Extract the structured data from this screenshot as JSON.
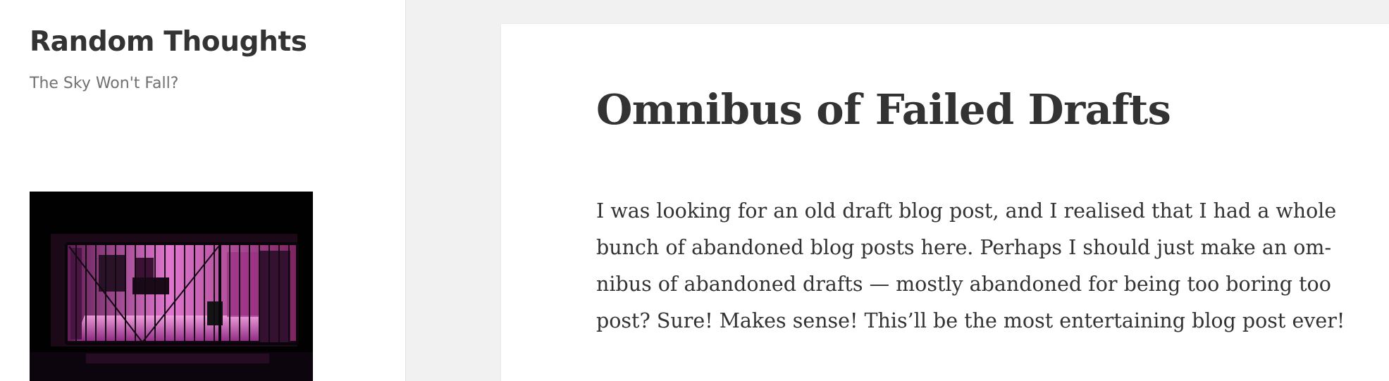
{
  "site": {
    "title": "Random Thoughts",
    "description": "The Sky Won't Fall?"
  },
  "sidebar": {
    "photo_icon": "widget-photo"
  },
  "post": {
    "title": "Omnibus of Failed Drafts",
    "body_lines": [
      "I was looking for an old draft blog post, and I realised that I had a whole",
      "bunch of abandoned blog posts here. Perhaps I should just make an om-",
      "nibus of abandoned drafts — mostly abandoned for being too boring too",
      "post? Sure! Makes sense! This’ll be the most entertaining blog post ever!"
    ]
  },
  "colors": {
    "page_background": "#f1f1f1",
    "panel_background": "#ffffff",
    "text": "#333333",
    "secondary_text": "#707070",
    "photo_accent": "#d548b8"
  }
}
